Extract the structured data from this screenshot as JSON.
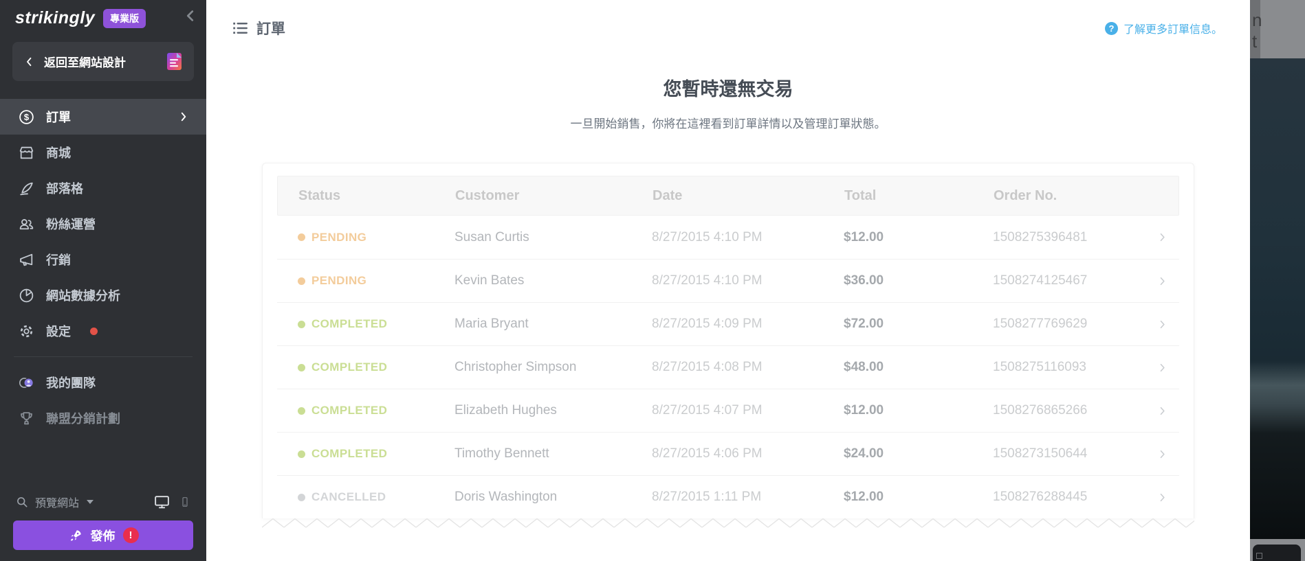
{
  "brand": {
    "logo": "strikingly",
    "plan_badge": "專業版"
  },
  "sidebar": {
    "back_button": "返回至網站設計",
    "items": [
      {
        "label": "訂單",
        "icon": "dollar-circle",
        "active": true
      },
      {
        "label": "商城",
        "icon": "storefront"
      },
      {
        "label": "部落格",
        "icon": "quill"
      },
      {
        "label": "粉絲運營",
        "icon": "people"
      },
      {
        "label": "行銷",
        "icon": "megaphone"
      },
      {
        "label": "網站數據分析",
        "icon": "pie-chart"
      },
      {
        "label": "設定",
        "icon": "gear",
        "notification_dot": true
      },
      {
        "label": "我的團隊",
        "icon": "team-avatars"
      },
      {
        "label": "聯盟分銷計劃",
        "icon": "trophy"
      }
    ],
    "preview_label": "預覽網站",
    "publish_label": "發佈",
    "publish_badge": "!"
  },
  "header": {
    "title": "訂單",
    "help_link": "了解更多訂單信息。"
  },
  "empty_state": {
    "title": "您暫時還無交易",
    "subtitle": "一旦開始銷售，你將在這裡看到訂單詳情以及管理訂單狀態。"
  },
  "orders_table": {
    "columns": [
      "Status",
      "Customer",
      "Date",
      "Total",
      "Order No."
    ],
    "rows": [
      {
        "status": "PENDING",
        "status_color": "#f3cc9b",
        "customer": "Susan Curtis",
        "date": "8/27/2015 4:10 PM",
        "total": "$12.00",
        "order_no": "1508275396481"
      },
      {
        "status": "PENDING",
        "status_color": "#f3cc9b",
        "customer": "Kevin Bates",
        "date": "8/27/2015 4:10 PM",
        "total": "$36.00",
        "order_no": "1508274125467"
      },
      {
        "status": "COMPLETED",
        "status_color": "#cade94",
        "customer": "Maria Bryant",
        "date": "8/27/2015 4:09 PM",
        "total": "$72.00",
        "order_no": "1508277769629"
      },
      {
        "status": "COMPLETED",
        "status_color": "#cade94",
        "customer": "Christopher Simpson",
        "date": "8/27/2015 4:08 PM",
        "total": "$48.00",
        "order_no": "1508275116093"
      },
      {
        "status": "COMPLETED",
        "status_color": "#cade94",
        "customer": "Elizabeth Hughes",
        "date": "8/27/2015 4:07 PM",
        "total": "$12.00",
        "order_no": "1508276865266"
      },
      {
        "status": "COMPLETED",
        "status_color": "#cade94",
        "customer": "Timothy Bennett",
        "date": "8/27/2015 4:06 PM",
        "total": "$24.00",
        "order_no": "1508273150644"
      },
      {
        "status": "CANCELLED",
        "status_color": "#d3d5d7",
        "customer": "Doris Washington",
        "date": "8/27/2015 1:11 PM",
        "total": "$12.00",
        "order_no": "1508276288445"
      }
    ]
  },
  "icons": {
    "question": "?",
    "dollar": "$"
  },
  "background": {
    "letters": [
      "n",
      "t"
    ]
  },
  "colors": {
    "accent_purple": "#8a50e0",
    "link_blue": "#49b0e8",
    "badge_red": "#e92e4e",
    "pending": "#f3cc9b",
    "completed": "#cade94",
    "cancelled": "#d3d5d7"
  }
}
